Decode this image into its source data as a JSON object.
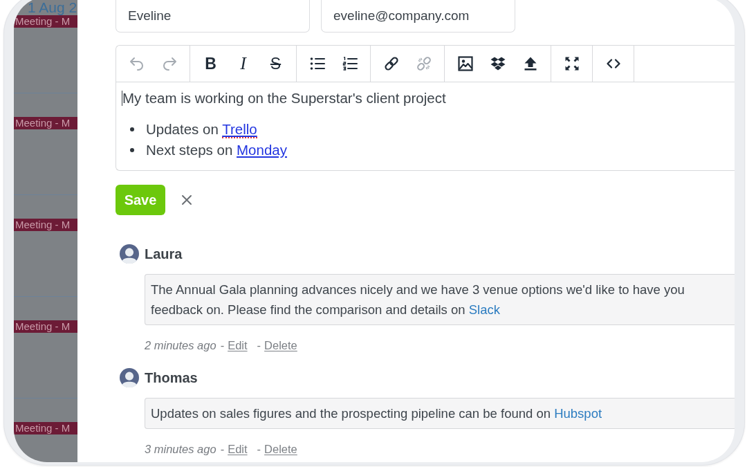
{
  "calendar": {
    "date": "1 Aug 2",
    "events": [
      {
        "title": "Meeting - M"
      },
      {
        "title": "Meeting - M"
      },
      {
        "title": "Meeting - M"
      },
      {
        "title": "Meeting - M"
      },
      {
        "title": "Meeting - M"
      }
    ]
  },
  "form": {
    "fields": [
      {
        "value": "Eveline"
      },
      {
        "value": "eveline@company.com"
      }
    ]
  },
  "editor": {
    "focused": true,
    "toolbar": [
      {
        "buttons": [
          {
            "kind": "undo",
            "disabled": true
          },
          {
            "kind": "redo",
            "disabled": true
          }
        ]
      },
      {
        "buttons": [
          {
            "kind": "bold",
            "label": "B",
            "disabled": false
          },
          {
            "kind": "italic",
            "label": "I",
            "disabled": false
          },
          {
            "kind": "strike",
            "label": "S",
            "disabled": false
          }
        ]
      },
      {
        "buttons": [
          {
            "kind": "bullets",
            "disabled": false
          },
          {
            "kind": "numbers",
            "disabled": false
          }
        ]
      },
      {
        "buttons": [
          {
            "kind": "link",
            "disabled": false
          },
          {
            "kind": "unlink",
            "disabled": true
          }
        ]
      },
      {
        "buttons": [
          {
            "kind": "image",
            "disabled": false
          },
          {
            "kind": "dropbox",
            "disabled": false
          },
          {
            "kind": "upload",
            "disabled": false
          }
        ]
      },
      {
        "buttons": [
          {
            "kind": "fullscreen",
            "disabled": false
          }
        ]
      },
      {
        "buttons": [
          {
            "kind": "code",
            "disabled": false
          }
        ]
      }
    ],
    "paragraph": "My team is working on the Superstar's client project",
    "bullets": [
      {
        "text": "Updates on",
        "link": "Trello",
        "misspelled": true
      },
      {
        "text": "Next steps on",
        "link": "Monday",
        "misspelled": false
      }
    ]
  },
  "actions": {
    "save": "Save"
  },
  "comments": [
    {
      "author": "Laura",
      "text": "The Annual Gala planning advances nicely and we have 3 venue options we'd like to have you feedback on. Please find the comparison and details on",
      "link": "Slack",
      "time": "2 minutes ago",
      "actions": [
        {
          "prefix": "-",
          "label": "Edit"
        },
        {
          "prefix": "-",
          "label": "Delete"
        }
      ]
    },
    {
      "author": "Thomas",
      "text": "Updates on sales figures and the prospecting pipeline can be found on",
      "link": "Hubspot",
      "time": "3 minutes ago",
      "actions": [
        {
          "prefix": "-",
          "label": "Edit"
        },
        {
          "prefix": "-",
          "label": "Delete"
        }
      ]
    }
  ]
}
